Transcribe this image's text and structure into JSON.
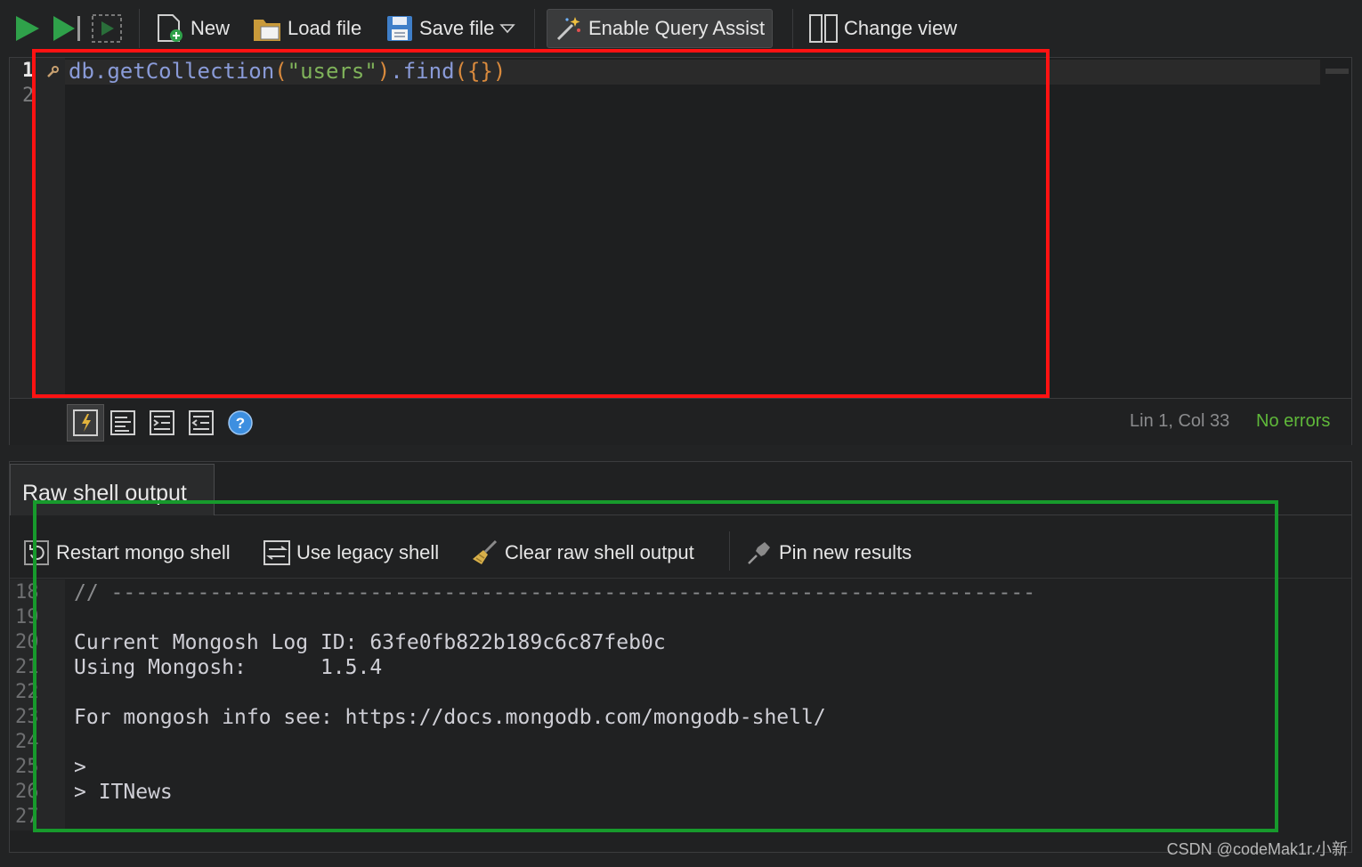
{
  "toolbar": {
    "new_label": "New",
    "load_label": "Load file",
    "save_label": "Save file",
    "query_assist_label": "Enable Query Assist",
    "change_view_label": "Change view"
  },
  "editor": {
    "line_numbers": [
      "1",
      "2"
    ],
    "code": {
      "obj": "db.",
      "method": "getCollection",
      "paren_open": "(",
      "string": "\"users\"",
      "paren_close": ")",
      "dot": ".",
      "find": "find",
      "args": "({})"
    },
    "cursor_position": "Lin 1, Col 33",
    "error_status": "No errors"
  },
  "output": {
    "tab_label": "Raw shell output",
    "restart_label": "Restart mongo shell",
    "legacy_label": "Use legacy shell",
    "clear_label": "Clear raw shell output",
    "pin_label": "Pin new results",
    "line_numbers": [
      "18",
      "19",
      "20",
      "21",
      "22",
      "23",
      "24",
      "25",
      "26",
      "27"
    ],
    "lines": {
      "l18": "// ---------------------------------------------------------------------------",
      "l20": "Current Mongosh Log ID: 63fe0fb822b189c6c87feb0c",
      "l21": "Using Mongosh:      1.5.4",
      "l23": "For mongosh info see: https://docs.mongodb.com/mongodb-shell/",
      "l25": ">",
      "l26": "> ITNews"
    }
  },
  "watermark": "CSDN @codeMak1r.小新",
  "colors": {
    "accent_green": "#2fa14a",
    "no_errors": "#5fb83a",
    "highlight_red": "#ff1212",
    "highlight_green": "#179a2c",
    "help_blue": "#3d8fe0"
  }
}
